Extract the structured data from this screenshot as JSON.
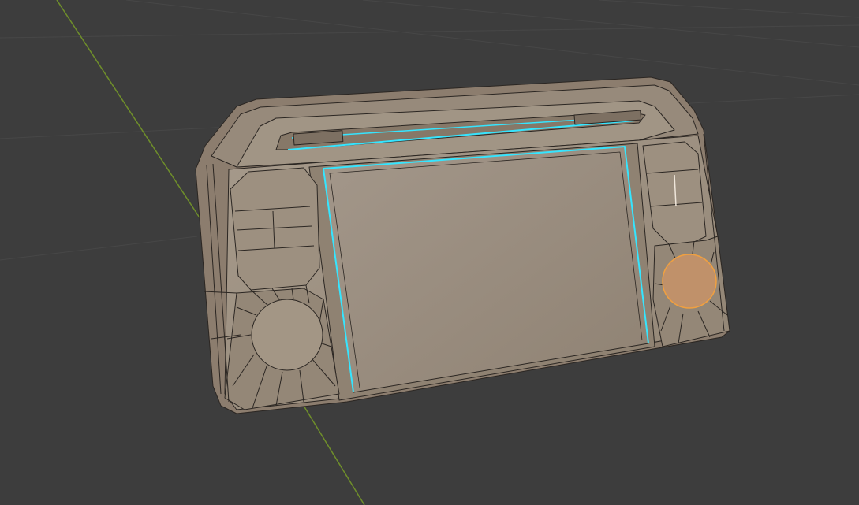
{
  "viewport": {
    "background": "#3d3d3d",
    "grid_color": "#464646",
    "y_axis_color": "#6a8a2a"
  },
  "model": {
    "object": "handheld-console-mesh",
    "body_color": "#8c7d6e",
    "face_color": "#a09383",
    "screen_color": "#9a8d7e",
    "edge_color": "#2b2622",
    "selected_edge_color": "#35e5ff",
    "selected_face_color": "#c89060",
    "selected_face_outline": "#f0a040"
  }
}
